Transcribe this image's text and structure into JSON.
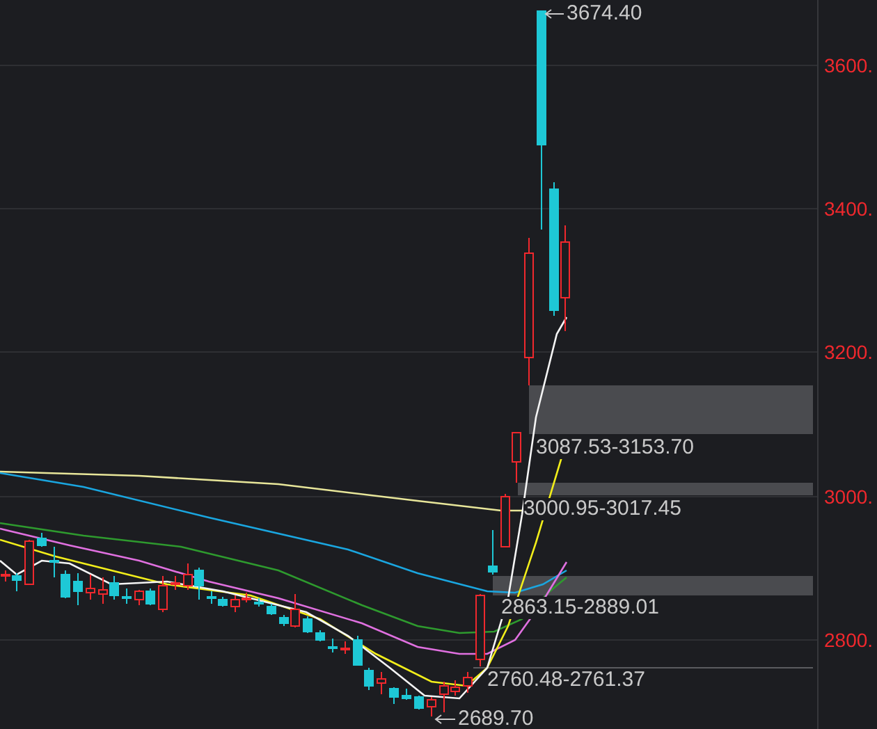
{
  "chart": {
    "y_axis_labels": [
      "3600.",
      "3400.",
      "3200.",
      "3000.",
      "2800."
    ],
    "price_marks": [
      {
        "kind": "high",
        "label": "3674.40"
      },
      {
        "kind": "low",
        "label": "2689.70"
      }
    ],
    "gap_zones": [
      {
        "kind": "band",
        "label": "3087.53-3153.70"
      },
      {
        "kind": "band",
        "label": "3000.95-3017.45"
      },
      {
        "kind": "band",
        "label": "2863.15-2889.01"
      },
      {
        "kind": "line",
        "label": "2760.48-2761.37"
      }
    ]
  }
}
